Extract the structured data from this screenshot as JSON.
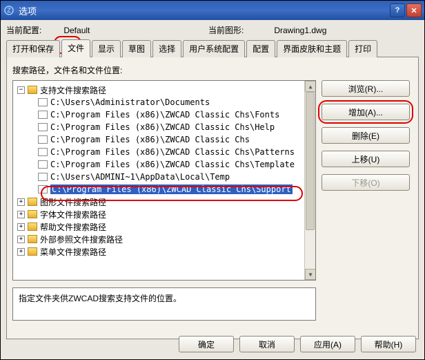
{
  "window": {
    "title": "选项"
  },
  "toprow": {
    "config_label": "当前配置:",
    "config_value": "Default",
    "drawing_label": "当前图形:",
    "drawing_value": "Drawing1.dwg"
  },
  "tabs": [
    "打开和保存",
    "文件",
    "显示",
    "草图",
    "选择",
    "用户系统配置",
    "配置",
    "界面皮肤和主题",
    "打印"
  ],
  "active_tab": 1,
  "section_label": "搜索路径，文件名和文件位置:",
  "tree": {
    "root": {
      "label": "支持文件搜索路径",
      "expanded": true,
      "paths": [
        "C:\\Users\\Administrator\\Documents",
        "C:\\Program Files (x86)\\ZWCAD Classic Chs\\Fonts",
        "C:\\Program Files (x86)\\ZWCAD Classic Chs\\Help",
        "C:\\Program Files (x86)\\ZWCAD Classic Chs",
        "C:\\Program Files (x86)\\ZWCAD Classic Chs\\Patterns",
        "C:\\Program Files (x86)\\ZWCAD Classic Chs\\Template",
        "C:\\Users\\ADMINI~1\\AppData\\Local\\Temp",
        "C:\\Program Files (x86)\\ZWCAD Classic Chs\\Support"
      ],
      "selected_index": 7
    },
    "others": [
      "图形文件搜索路径",
      "字体文件搜索路径",
      "帮助文件搜索路径",
      "外部参照文件搜索路径",
      "菜单文件搜索路径"
    ]
  },
  "side_buttons": {
    "browse": "浏览(R)...",
    "add": "增加(A)...",
    "delete": "删除(E)",
    "moveup": "上移(U)",
    "movedown": "下移(O)"
  },
  "description": "指定文件夹供ZWCAD搜索支持文件的位置。",
  "bottom": {
    "ok": "确定",
    "cancel": "取消",
    "apply": "应用(A)",
    "help": "帮助(H)"
  }
}
